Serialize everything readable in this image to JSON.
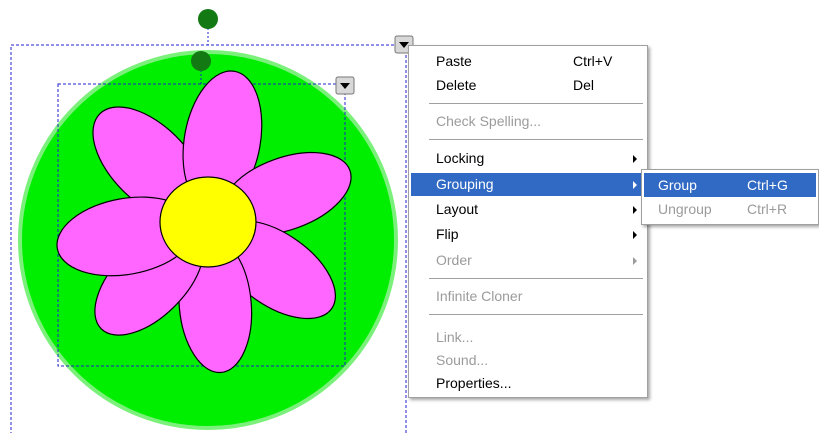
{
  "context_menu": {
    "items": [
      {
        "label": "Paste",
        "shortcut": "Ctrl+V",
        "enabled": true
      },
      {
        "label": "Delete",
        "shortcut": "Del",
        "enabled": true
      },
      {
        "label": "Check Spelling...",
        "enabled": false
      },
      {
        "label": "Locking",
        "submenu": true,
        "enabled": true
      },
      {
        "label": "Grouping",
        "submenu": true,
        "enabled": true,
        "highlighted": true
      },
      {
        "label": "Layout",
        "submenu": true,
        "enabled": true
      },
      {
        "label": "Flip",
        "submenu": true,
        "enabled": true
      },
      {
        "label": "Order",
        "submenu": true,
        "enabled": false
      },
      {
        "label": "Infinite Cloner",
        "enabled": false
      },
      {
        "label": "Link...",
        "enabled": false
      },
      {
        "label": "Sound...",
        "enabled": false
      },
      {
        "label": "Properties...",
        "enabled": true
      }
    ]
  },
  "grouping_submenu": {
    "items": [
      {
        "label": "Group",
        "shortcut": "Ctrl+G",
        "enabled": true,
        "highlighted": true
      },
      {
        "label": "Ungroup",
        "shortcut": "Ctrl+R",
        "enabled": false
      }
    ]
  },
  "canvas": {
    "shapes": [
      "circle",
      "flower"
    ],
    "colors": {
      "circle_fill": "#00ee00",
      "circle_outline": "#7bf07b",
      "petal_fill": "#ff66ff",
      "center_fill": "#ffff00",
      "handle_fill": "#137a13",
      "selection_border": "#2222cc",
      "menu_highlight": "#316ac5"
    }
  }
}
